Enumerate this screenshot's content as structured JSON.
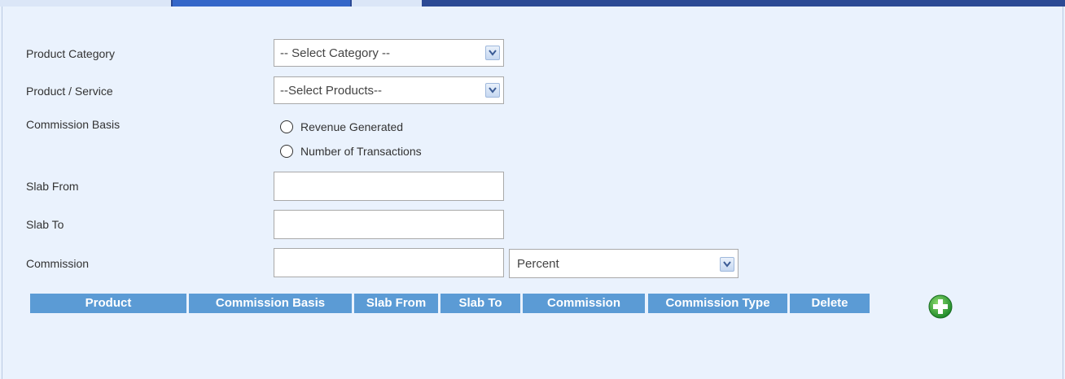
{
  "form": {
    "product_category": {
      "label": "Product Category",
      "value": "-- Select Category --"
    },
    "product_service": {
      "label": "Product / Service",
      "value": "--Select Products--"
    },
    "commission_basis": {
      "label": "Commission Basis",
      "options": [
        "Revenue Generated",
        "Number of Transactions"
      ]
    },
    "slab_from": {
      "label": "Slab From",
      "value": ""
    },
    "slab_to": {
      "label": "Slab To",
      "value": ""
    },
    "commission": {
      "label": "Commission",
      "value": "",
      "type_value": "Percent"
    }
  },
  "table": {
    "headers": [
      "Product",
      "Commission Basis",
      "Slab From",
      "Slab To",
      "Commission",
      "Commission Type",
      "Delete"
    ]
  },
  "icons": {
    "add": "plus-circle-icon",
    "dropdown": "chevron-down-icon"
  },
  "colors": {
    "header_bg": "#5b9bd5",
    "add_green": "#3aa53a",
    "topbar": "#2c4a94"
  }
}
